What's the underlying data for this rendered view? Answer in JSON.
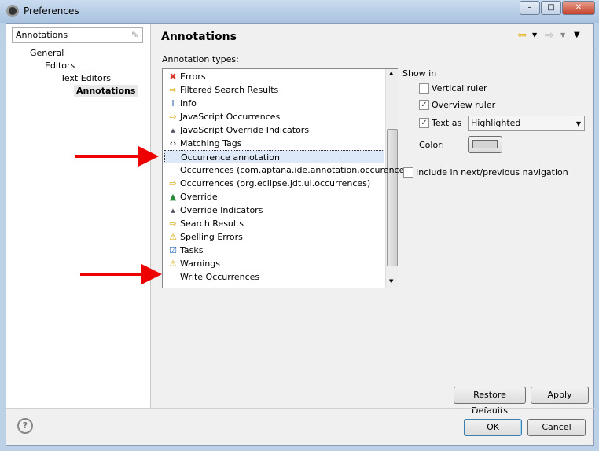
{
  "window": {
    "title": "Preferences"
  },
  "sidebar": {
    "filter_value": "Annotations",
    "tree": [
      {
        "label": "General"
      },
      {
        "label": "Editors"
      },
      {
        "label": "Text Editors"
      },
      {
        "label": "Annotations"
      }
    ]
  },
  "header": {
    "title": "Annotations"
  },
  "main": {
    "annotation_types_label": "Annotation types:",
    "items": [
      {
        "label": "Errors",
        "icon": "error-icon",
        "glyph": "✖",
        "color": "#d9382e"
      },
      {
        "label": "Filtered Search Results",
        "icon": "arrow-right-icon",
        "glyph": "⇨",
        "color": "#d9a400"
      },
      {
        "label": "Info",
        "icon": "info-icon",
        "glyph": "i",
        "color": "#1f4fa8"
      },
      {
        "label": "JavaScript Occurrences",
        "icon": "arrow-right-icon",
        "glyph": "⇨",
        "color": "#d9a400"
      },
      {
        "label": "JavaScript Override Indicators",
        "icon": "triangle-up-icon",
        "glyph": "▴",
        "color": "#556"
      },
      {
        "label": "Matching Tags",
        "icon": "angle-brackets-icon",
        "glyph": "‹›",
        "color": "#000"
      },
      {
        "label": "Occurrence annotation",
        "icon": "",
        "glyph": "",
        "color": "#000",
        "selected": true
      },
      {
        "label": "Occurrences (com.aptana.ide.annotation.occurence)",
        "icon": "",
        "glyph": "",
        "color": "#000"
      },
      {
        "label": "Occurrences (org.eclipse.jdt.ui.occurrences)",
        "icon": "arrow-right-icon",
        "glyph": "⇨",
        "color": "#d9a400"
      },
      {
        "label": "Override",
        "icon": "triangle-up-icon",
        "glyph": "▲",
        "color": "#2e8b3a"
      },
      {
        "label": "Override Indicators",
        "icon": "triangle-up-icon",
        "glyph": "▴",
        "color": "#556"
      },
      {
        "label": "Search Results",
        "icon": "arrow-right-icon",
        "glyph": "⇨",
        "color": "#d9a400"
      },
      {
        "label": "Spelling Errors",
        "icon": "warning-icon",
        "glyph": "⚠",
        "color": "#d9a400"
      },
      {
        "label": "Tasks",
        "icon": "task-icon",
        "glyph": "☑",
        "color": "#2a6cc0"
      },
      {
        "label": "Warnings",
        "icon": "warning-icon",
        "glyph": "⚠",
        "color": "#d9a400"
      },
      {
        "label": "Write Occurrences",
        "icon": "",
        "glyph": "",
        "color": "#000"
      }
    ],
    "show_in_label": "Show in",
    "vertical_ruler": {
      "label": "Vertical ruler",
      "checked": false
    },
    "overview_ruler": {
      "label": "Overview ruler",
      "checked": true
    },
    "text_as": {
      "label": "Text as",
      "checked": true,
      "value": "Highlighted"
    },
    "color_label": "Color:",
    "color_value": "#d4d4d4",
    "include_nav": {
      "label": "Include in next/previous navigation",
      "checked": false
    },
    "restore_defaults": "Restore Defaults",
    "apply": "Apply"
  },
  "footer": {
    "ok": "OK",
    "cancel": "Cancel"
  }
}
